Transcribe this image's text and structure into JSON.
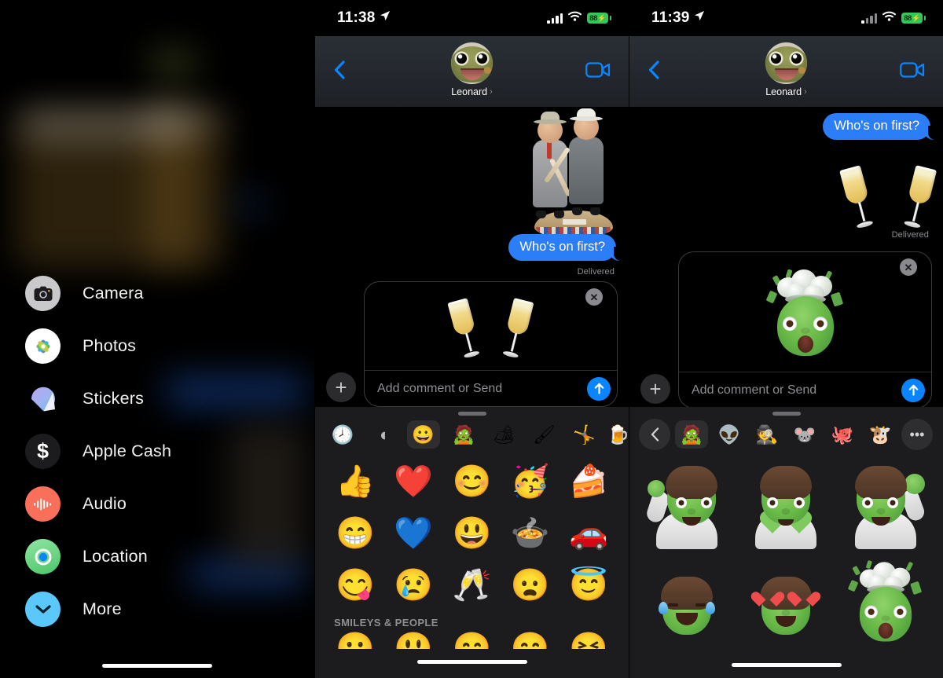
{
  "panels": {
    "left": {
      "name": "imessage-app-drawer",
      "apps": [
        {
          "label": "Camera",
          "icon": "camera-icon",
          "color": "#c9c9cc"
        },
        {
          "label": "Photos",
          "icon": "photos-icon",
          "color": "#ffffff"
        },
        {
          "label": "Stickers",
          "icon": "stickers-icon",
          "color": "#9b8cf0"
        },
        {
          "label": "Apple Cash",
          "icon": "apple-cash-icon",
          "color": "#1c1c1e"
        },
        {
          "label": "Audio",
          "icon": "audio-waveform-icon",
          "color": "#fa6f5a"
        },
        {
          "label": "Location",
          "icon": "location-icon",
          "color": "#5ed47f"
        },
        {
          "label": "More",
          "icon": "chevron-down-icon",
          "color": "#5ac8fa"
        }
      ]
    },
    "middle": {
      "status": {
        "time": "11:38",
        "location_arrow": "location-arrow-icon",
        "battery": "88",
        "charging": true
      },
      "nav": {
        "back": "back-chevron-icon",
        "contact_name": "Leonard",
        "disclosure": "›",
        "facetime": "video-camera-icon"
      },
      "thread": {
        "sticker": "bobblehead-sticker",
        "message": "Who's on first?",
        "status": "Delivered"
      },
      "compose": {
        "plus": "plus-icon",
        "staged_sticker": "clinking-glasses-emoji",
        "remove": "close-icon",
        "placeholder": "Add comment or Send",
        "send": "send-arrow-icon"
      },
      "tray": {
        "grabber": "drag-handle",
        "categories": [
          {
            "name": "recents",
            "glyph": "🕗",
            "active": false
          },
          {
            "name": "stickers-recent",
            "glyph": "◖",
            "active": false
          },
          {
            "name": "emoji",
            "glyph": "😀",
            "active": true
          },
          {
            "name": "memoji-zombie",
            "glyph": "🧟",
            "active": false
          },
          {
            "name": "sticker-pack-camping",
            "glyph": "🏕",
            "active": false
          },
          {
            "name": "sticker-pack-paint",
            "glyph": "🖌",
            "active": false
          },
          {
            "name": "sticker-pack-gymnast",
            "glyph": "🤸",
            "active": false
          },
          {
            "name": "sticker-pack-more",
            "glyph": "🍺",
            "active": false
          }
        ],
        "frequently_used": [
          "👍",
          "❤️",
          "😊",
          "🥳",
          "🍰",
          "😁",
          "💙",
          "😃",
          "🍲",
          "🚗",
          "😋",
          "😢",
          "🥂",
          "😦",
          "😇"
        ],
        "section_title": "SMILEYS & PEOPLE",
        "next_row": [
          "😀",
          "😃",
          "😄",
          "😁",
          "😆"
        ]
      }
    },
    "right": {
      "status": {
        "time": "11:39",
        "location_arrow": "location-arrow-icon",
        "battery": "88",
        "charging": true
      },
      "nav": {
        "back": "back-chevron-icon",
        "contact_name": "Leonard",
        "disclosure": "›",
        "facetime": "video-camera-icon"
      },
      "thread": {
        "message": "Who's on first?",
        "sticker": "clinking-glasses-emoji",
        "status": "Delivered"
      },
      "compose": {
        "plus": "plus-icon",
        "staged_sticker": "memoji-exploding-head",
        "remove": "close-icon",
        "placeholder": "Add comment or Send",
        "send": "send-arrow-icon"
      },
      "tray": {
        "grabber": "drag-handle",
        "back_button": "back-chevron-icon",
        "categories": [
          {
            "name": "memoji-zombie",
            "glyph": "🧟",
            "active": true
          },
          {
            "name": "memoji-alien-punk",
            "glyph": "👽",
            "active": false
          },
          {
            "name": "memoji-detective",
            "glyph": "🕵",
            "active": false
          },
          {
            "name": "animoji-mouse",
            "glyph": "🐭",
            "active": false
          },
          {
            "name": "animoji-octopus",
            "glyph": "🐙",
            "active": false
          },
          {
            "name": "animoji-cow",
            "glyph": "🐮",
            "active": false
          }
        ],
        "more_button": "ellipsis-icon",
        "stickers": [
          "memoji-thumbs-up",
          "memoji-heart-hands",
          "memoji-waving",
          "memoji-laughing-tears",
          "memoji-heart-eyes",
          "memoji-exploding-head"
        ]
      }
    }
  },
  "colors": {
    "bubble_blue": "#2C7EF8",
    "accent_blue": "#0A84FF",
    "battery_green": "#34C759",
    "tray_bg": "#1C1C1E",
    "secondary_text": "#8E8E93"
  }
}
